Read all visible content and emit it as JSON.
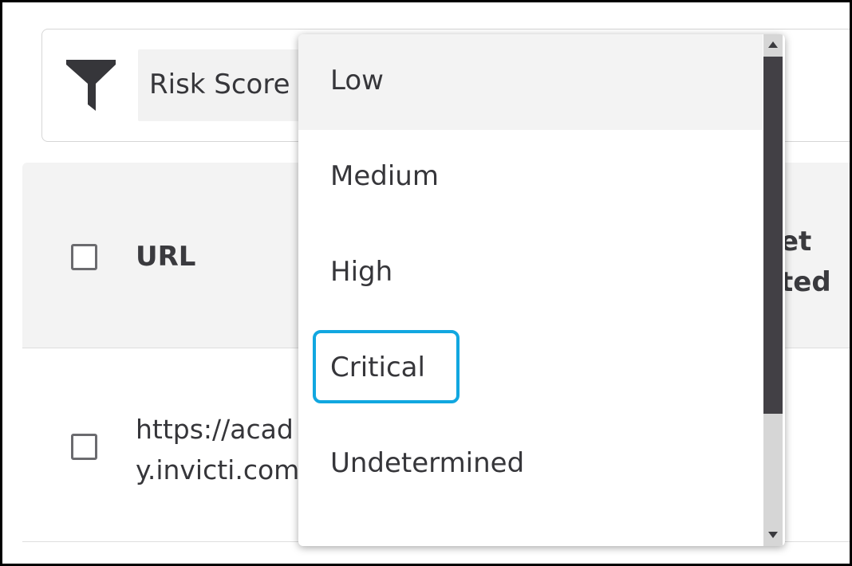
{
  "filter": {
    "icon": "filter-funnel-icon",
    "chip_label": "Risk Score"
  },
  "table": {
    "header": {
      "url_label": "URL",
      "partial_column_label_line1": "et",
      "partial_column_label_line2": "ted"
    },
    "rows": [
      {
        "url_line1": "https://acad",
        "url_line2": "y.invicti.com"
      }
    ]
  },
  "dropdown": {
    "options": [
      {
        "label": "Low",
        "highlighted": true
      },
      {
        "label": "Medium"
      },
      {
        "label": "High"
      },
      {
        "label": "Critical",
        "focused": true
      },
      {
        "label": "Undetermined"
      }
    ]
  },
  "colors": {
    "focus_ring": "#11a7e0",
    "icon": "#36363a",
    "header_bg": "#f3f3f3",
    "scroll_thumb": "#424045"
  }
}
